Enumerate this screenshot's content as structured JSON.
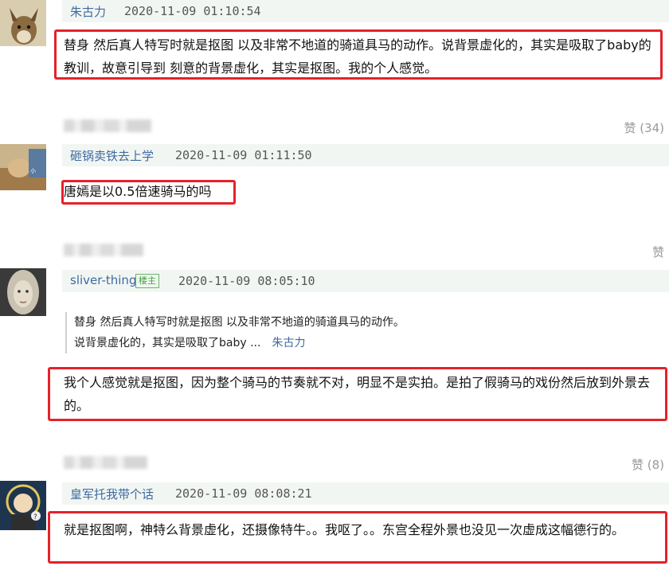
{
  "comments": [
    {
      "user": "朱古力",
      "time": "2020-11-09 01:10:54",
      "text": "替身 然后真人特写时就是抠图 以及非常不地道的骑道具马的动作。说背景虚化的，其实是吸取了baby的教训，故意引导到 刻意的背景虚化，其实是抠图。我的个人感觉。",
      "likes": "赞 (34)"
    },
    {
      "user": "砸锅卖铁去上学",
      "time": "2020-11-09 01:11:50",
      "text": "唐嫣是以0.5倍速骑马的吗",
      "likes": "赞"
    },
    {
      "user": "sliver-thing",
      "badge": "楼主",
      "time": "2020-11-09 08:05:10",
      "quote_line1": "替身 然后真人特写时就是抠图 以及非常不地道的骑道具马的动作。",
      "quote_line2": "说背景虚化的，其实是吸取了baby ...",
      "quote_user": "朱古力",
      "text": "我个人感觉就是抠图，因为整个骑马的节奏就不对，明显不是实拍。是拍了假骑马的戏份然后放到外景去的。",
      "likes": "赞 (8)"
    },
    {
      "user": "皇军托我带个话",
      "time": "2020-11-09 08:08:21",
      "text": "就是抠图啊，神特么背景虚化，还摄像特牛。。我呕了。。东宫全程外景也没见一次虚成这幅德行的。"
    }
  ],
  "colors": {
    "highlight": "#e4222a",
    "username": "#3d6ba0",
    "header_bg": "#f2f6f3"
  }
}
